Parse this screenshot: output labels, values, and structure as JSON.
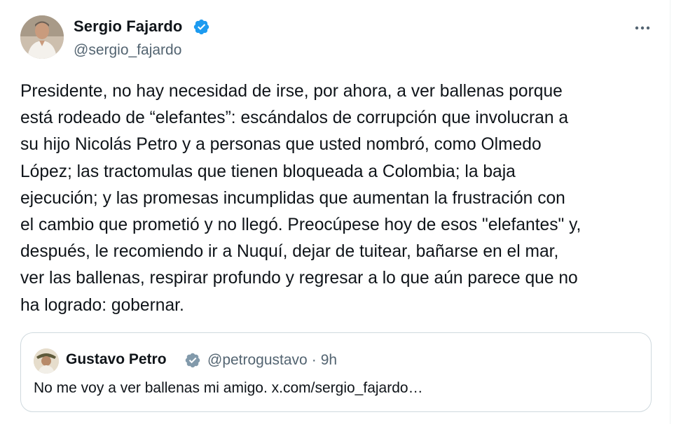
{
  "author": {
    "name": "Sergio Fajardo",
    "handle": "@sergio_fajardo",
    "verified": true
  },
  "menu": {
    "more_icon": "more-horizontal-icon"
  },
  "tweet": {
    "lines": [
      "Presidente, no hay necesidad de irse, por ahora, a ver ballenas porque",
      "está rodeado de “elefantes”: escándalos de corrupción que involucran a",
      "su hijo Nicolás Petro y a personas que usted nombró, como Olmedo",
      "López; las tractomulas que tienen bloqueada a Colombia; la baja",
      "ejecución; y las promesas incumplidas que aumentan la frustración con",
      "el cambio que prometió y no llegó. Preocúpese hoy de esos \"elefantes\" y,",
      "después, le recomiendo ir a Nuquí, dejar de tuitear, bañarse en el mar,",
      "ver las ballenas, respirar profundo y regresar a lo que aún parece que no",
      "ha logrado: gobernar."
    ]
  },
  "quote": {
    "name": "Gustavo Petro",
    "handle": "@petrogustavo",
    "separator": "·",
    "time": "9h",
    "text": "No me voy a ver ballenas mi amigo. x.com/sergio_fajardo…",
    "verified_badge_color": "#829aab"
  },
  "colors": {
    "verified_blue": "#1d9bf0",
    "secondary_text": "#536471",
    "border": "#cfd9de"
  }
}
